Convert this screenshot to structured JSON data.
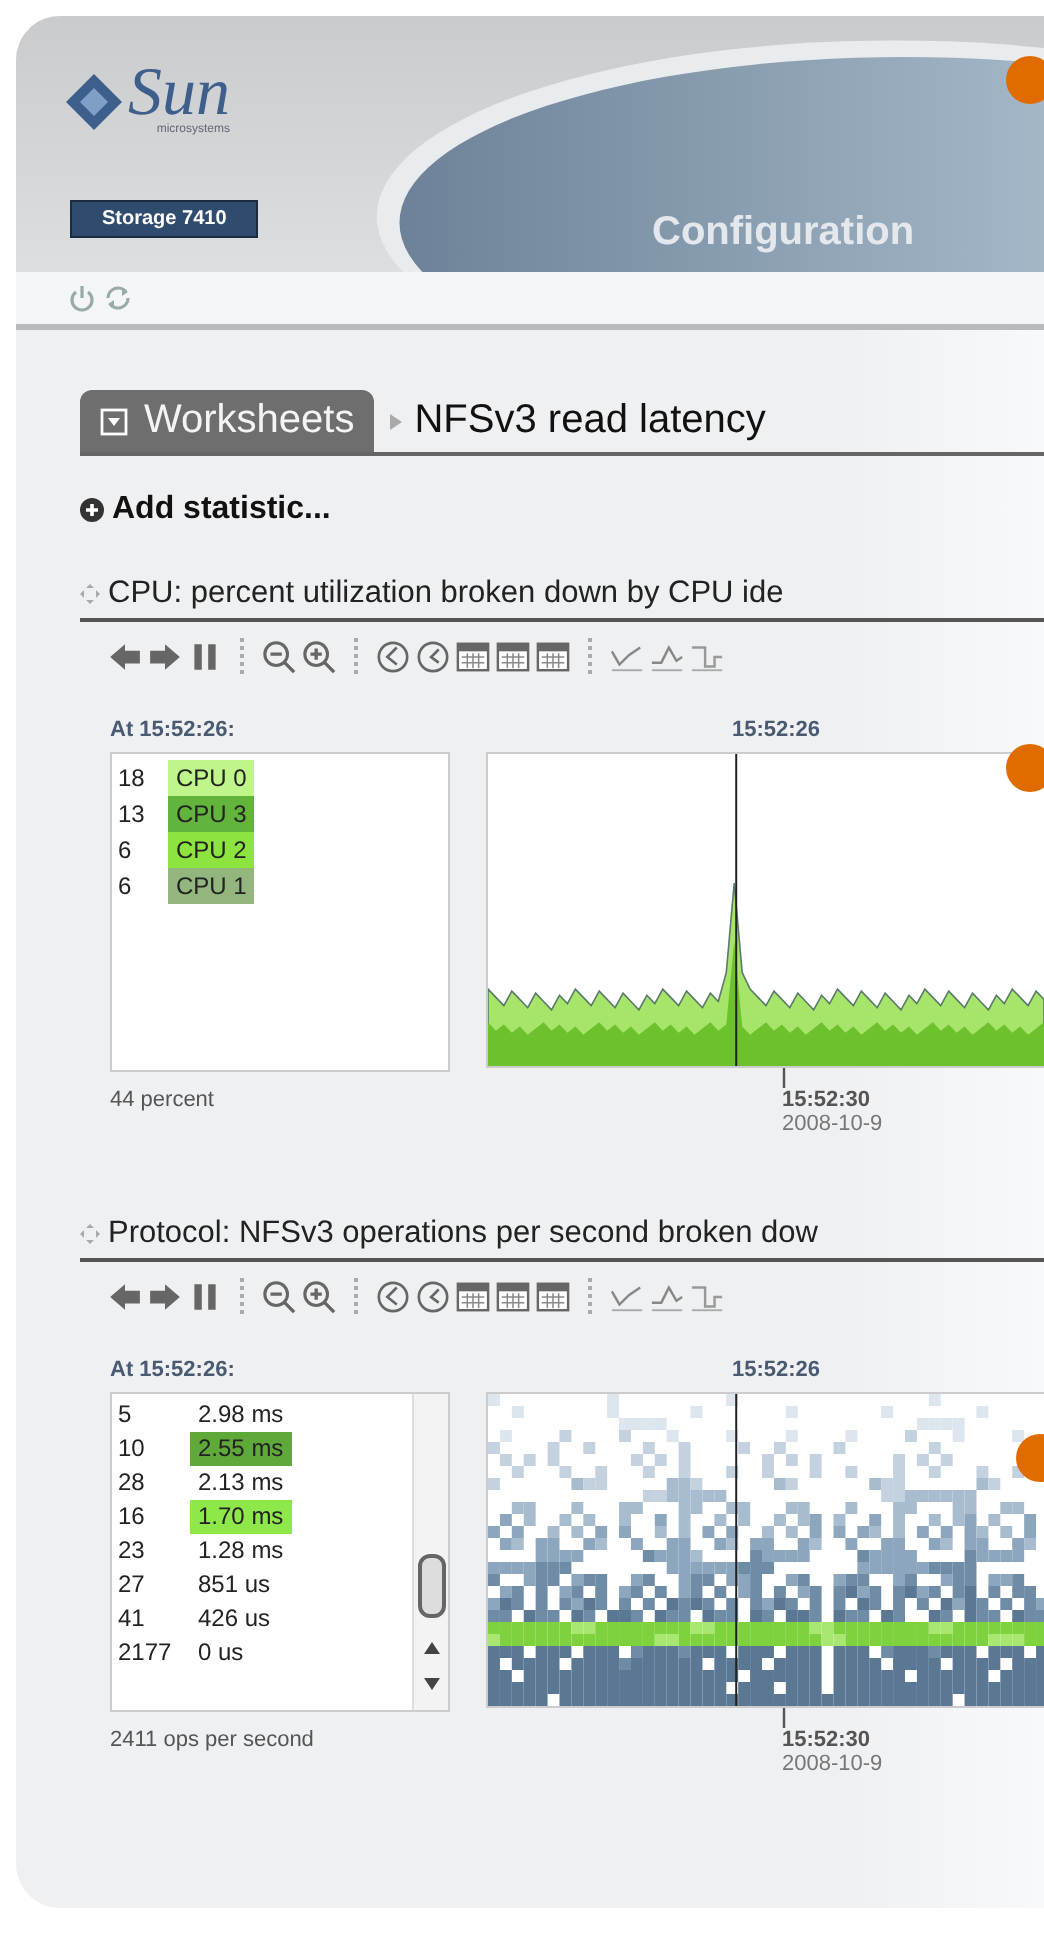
{
  "header": {
    "logo": "Sun",
    "logo_sub": "microsystems",
    "product": "Storage 7410",
    "section": "Configuration"
  },
  "breadcrumb": {
    "root": "Worksheets",
    "current": "NFSv3 read latency"
  },
  "add_statistic": "Add statistic...",
  "statistics": [
    {
      "kind": "area",
      "title": "CPU: percent utilization broken down by CPU ide",
      "time_label": "At 15:52:26:",
      "cursor_time": "15:52:26",
      "tick_time": "15:52:30",
      "tick_date": "2008-10-9",
      "total": "44 percent",
      "scrollbar": false,
      "rows": [
        {
          "value": "18",
          "label": "CPU 0",
          "color": "#bff58a"
        },
        {
          "value": "13",
          "label": "CPU 3",
          "color": "#62b43c"
        },
        {
          "value": "6",
          "label": "CPU 2",
          "color": "#8ee43e"
        },
        {
          "value": "6",
          "label": "CPU 1",
          "color": "#92b67e"
        }
      ]
    },
    {
      "kind": "heatmap",
      "title": "Protocol: NFSv3 operations per second broken dow",
      "time_label": "At 15:52:26:",
      "cursor_time": "15:52:26",
      "tick_time": "15:52:30",
      "tick_date": "2008-10-9",
      "total": "2411 ops per second",
      "scrollbar": true,
      "rows": [
        {
          "value": "5",
          "label": "2.98 ms"
        },
        {
          "value": "10",
          "label": "2.55 ms",
          "color": "#5fa83a"
        },
        {
          "value": "28",
          "label": "2.13 ms"
        },
        {
          "value": "16",
          "label": "1.70 ms",
          "color": "#8ee84a"
        },
        {
          "value": "23",
          "label": "1.28 ms"
        },
        {
          "value": "27",
          "label": "851 us"
        },
        {
          "value": "41",
          "label": "426 us"
        },
        {
          "value": "2177",
          "label": "0 us"
        }
      ]
    }
  ]
}
